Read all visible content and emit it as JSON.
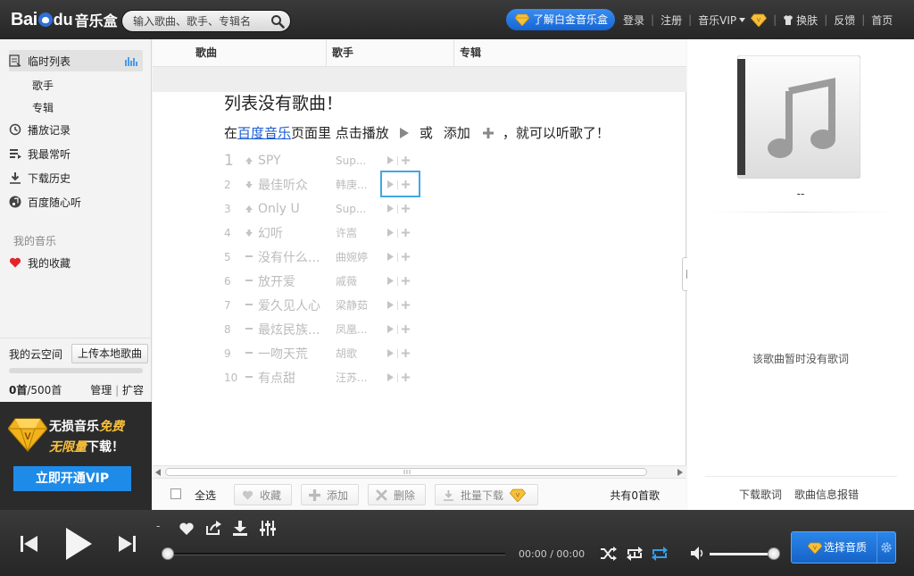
{
  "topbar": {
    "logo_bai": "Bai",
    "logo_du": "du",
    "logo_sub": "音乐盒",
    "search_placeholder": "输入歌曲、歌手、专辑名",
    "platinum_btn": "了解白金音乐盒",
    "nav": {
      "login": "登录",
      "register": "注册",
      "vip": "音乐VIP",
      "skin": "换肤",
      "feedback": "反馈",
      "home": "首页"
    }
  },
  "sidebar": {
    "items": [
      {
        "label": "临时列表"
      },
      {
        "label": "歌手"
      },
      {
        "label": "专辑"
      },
      {
        "label": "播放记录"
      },
      {
        "label": "我最常听"
      },
      {
        "label": "下载历史"
      },
      {
        "label": "百度随心听"
      }
    ],
    "my_music_label": "我的音乐",
    "favorites": "我的收藏",
    "cloud": {
      "label": "我的云空间",
      "upload": "上传本地歌曲",
      "count": "0首",
      "total": "/500首",
      "manage": "管理",
      "expand": "扩容",
      "used_fraction": 0
    }
  },
  "vip_promo": {
    "line1_a": "无损音乐",
    "line1_b": "免费",
    "line2_a": "无限量",
    "line2_b": "下载！",
    "button": "立即开通VIP"
  },
  "list": {
    "columns": [
      "歌曲",
      "歌手",
      "专辑"
    ],
    "empty_title": "列表没有歌曲！",
    "hint_prefix": "在",
    "hint_link": "百度音乐",
    "hint_mid": "页面里 点击播放",
    "hint_or": "或",
    "hint_add": "添加",
    "hint_suffix": "，就可以听歌了！",
    "songs": [
      {
        "rank": "1",
        "title": "SPY",
        "artist": "Sup..."
      },
      {
        "rank": "2",
        "title": "最佳听众",
        "artist": "韩庚..."
      },
      {
        "rank": "3",
        "title": "Only U",
        "artist": "Sup..."
      },
      {
        "rank": "4",
        "title": "幻听",
        "artist": "许嵩"
      },
      {
        "rank": "5",
        "title": "没有什么...",
        "artist": "曲婉婷"
      },
      {
        "rank": "6",
        "title": "放开爱",
        "artist": "戚薇"
      },
      {
        "rank": "7",
        "title": "爱久见人心",
        "artist": "梁静茹"
      },
      {
        "rank": "8",
        "title": "最炫民族...",
        "artist": "凤凰..."
      },
      {
        "rank": "9",
        "title": "一吻天荒",
        "artist": "胡歌"
      },
      {
        "rank": "10",
        "title": "有点甜",
        "artist": "汪苏..."
      }
    ],
    "toolbar": {
      "select_all": "全选",
      "favorite": "收藏",
      "add": "添加",
      "delete": "删除",
      "batch_download": "批量下载",
      "total": "共有0首歌"
    }
  },
  "right_panel": {
    "song_name": "--",
    "no_lyrics": "该歌曲暂时没有歌词",
    "download_lyrics": "下载歌词",
    "report": "歌曲信息报错"
  },
  "player": {
    "current_song": "-",
    "time": "00:00 / 00:00",
    "quality": "选择音质",
    "progress_fraction": 0,
    "volume_fraction": 1
  },
  "colors": {
    "accent_blue": "#1e8be8",
    "vip_gold": "#f7c03a",
    "highlight_box": "#3ea8e8",
    "link": "#1a5bd0"
  }
}
